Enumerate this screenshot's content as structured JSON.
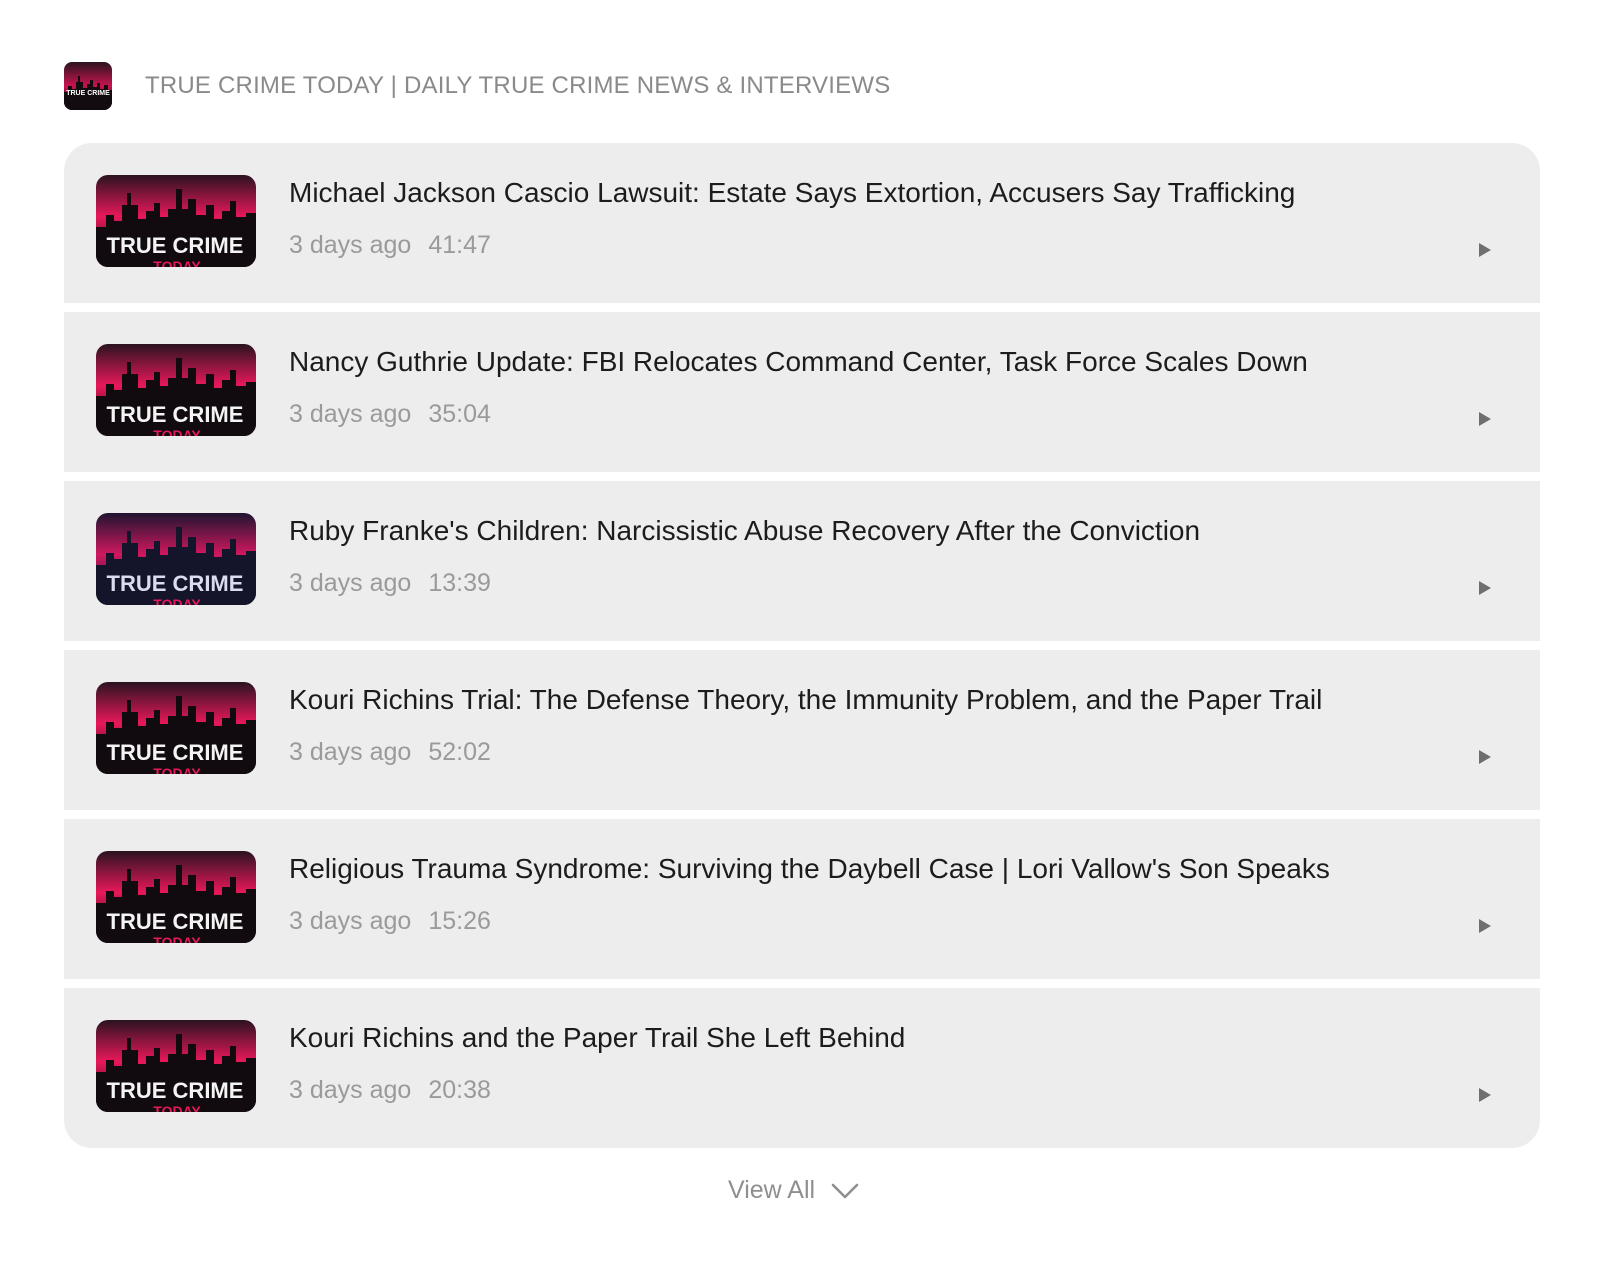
{
  "header": {
    "title": "TRUE CRIME TODAY | DAILY TRUE CRIME NEWS & INTERVIEWS",
    "artwork_text": "TRUE CRIME"
  },
  "episodes": [
    {
      "title": "Michael Jackson Cascio Lawsuit: Estate Says Extortion, Accusers Say Trafficking",
      "date": "3 days ago",
      "duration": "41:47",
      "art_text": "TRUE CRIME",
      "art_subtext": "TODAY"
    },
    {
      "title": "Nancy Guthrie Update: FBI Relocates Command Center, Task Force Scales Down",
      "date": "3 days ago",
      "duration": "35:04",
      "art_text": "TRUE CRIME",
      "art_subtext": "TODAY"
    },
    {
      "title": "Ruby Franke's Children: Narcissistic Abuse Recovery After the Conviction",
      "date": "3 days ago",
      "duration": "13:39",
      "art_text": "TRUE CRIME",
      "art_subtext": "TODAY"
    },
    {
      "title": "Kouri Richins Trial: The Defense Theory, the Immunity Problem, and the Paper Trail",
      "date": "3 days ago",
      "duration": "52:02",
      "art_text": "TRUE CRIME",
      "art_subtext": "TODAY"
    },
    {
      "title": "Religious Trauma Syndrome: Surviving the Daybell Case | Lori Vallow's Son Speaks",
      "date": "3 days ago",
      "duration": "15:26",
      "art_text": "TRUE CRIME",
      "art_subtext": "TODAY"
    },
    {
      "title": "Kouri Richins and the Paper Trail She Left Behind",
      "date": "3 days ago",
      "duration": "20:38",
      "art_text": "TRUE CRIME",
      "art_subtext": "TODAY"
    }
  ],
  "footer": {
    "view_all_label": "View All"
  },
  "colors": {
    "row_background": "#ededed",
    "title_text": "#1c1c1c",
    "meta_text": "#9a9a9a",
    "artwork_accent": "#e8185a",
    "artwork_dark": "#141414"
  },
  "icons": {
    "play": "play-icon",
    "view_all": "chevron-down-icon"
  }
}
